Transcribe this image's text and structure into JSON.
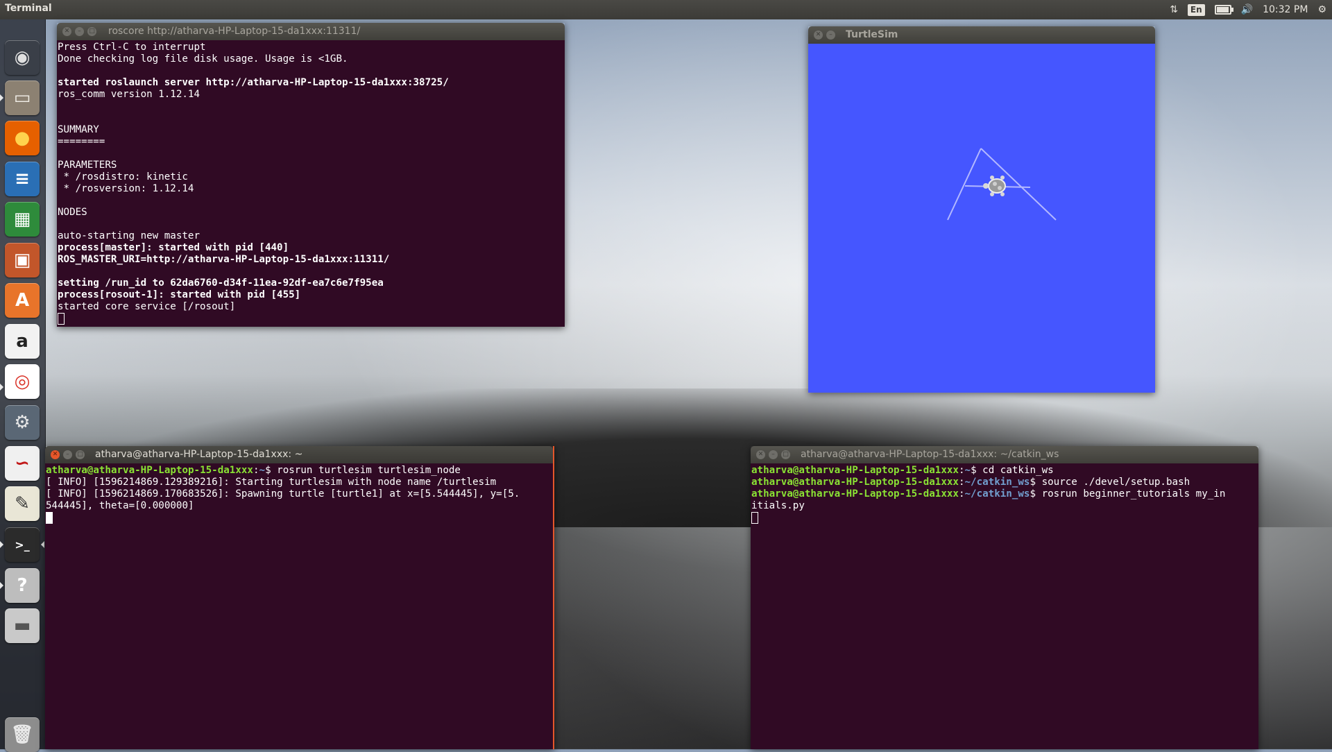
{
  "top_panel": {
    "app_name": "Terminal",
    "language": "En",
    "clock": "10:32 PM"
  },
  "launcher": {
    "items": [
      {
        "name": "dash-icon",
        "glyph": "◉"
      },
      {
        "name": "files-icon",
        "glyph": "▭"
      },
      {
        "name": "firefox-icon",
        "glyph": "●"
      },
      {
        "name": "writer-icon",
        "glyph": "≡"
      },
      {
        "name": "calc-icon",
        "glyph": "▦"
      },
      {
        "name": "impress-icon",
        "glyph": "▣"
      },
      {
        "name": "software-center-icon",
        "glyph": "A"
      },
      {
        "name": "amazon-icon",
        "glyph": "a"
      },
      {
        "name": "chrome-icon",
        "glyph": "◎"
      },
      {
        "name": "settings-icon",
        "glyph": "⚙"
      },
      {
        "name": "pdf-reader-icon",
        "glyph": "∽"
      },
      {
        "name": "text-editor-icon",
        "glyph": "✎"
      },
      {
        "name": "terminal-icon",
        "glyph": ">_"
      },
      {
        "name": "help-icon",
        "glyph": "?"
      },
      {
        "name": "drive-icon",
        "glyph": "▬"
      },
      {
        "name": "trash-icon",
        "glyph": "🗑"
      }
    ]
  },
  "roscore_window": {
    "title": "roscore http://atharva-HP-Laptop-15-da1xxx:11311/",
    "lines": [
      {
        "text": "Press Ctrl-C to interrupt",
        "bold": false
      },
      {
        "text": "Done checking log file disk usage. Usage is <1GB.",
        "bold": false
      },
      {
        "text": "",
        "bold": false
      },
      {
        "text": "started roslaunch server http://atharva-HP-Laptop-15-da1xxx:38725/",
        "bold": true
      },
      {
        "text": "ros_comm version 1.12.14",
        "bold": false
      },
      {
        "text": "",
        "bold": false
      },
      {
        "text": "",
        "bold": false
      },
      {
        "text": "SUMMARY",
        "bold": false
      },
      {
        "text": "========",
        "bold": false
      },
      {
        "text": "",
        "bold": false
      },
      {
        "text": "PARAMETERS",
        "bold": false
      },
      {
        "text": " * /rosdistro: kinetic",
        "bold": false
      },
      {
        "text": " * /rosversion: 1.12.14",
        "bold": false
      },
      {
        "text": "",
        "bold": false
      },
      {
        "text": "NODES",
        "bold": false
      },
      {
        "text": "",
        "bold": false
      },
      {
        "text": "auto-starting new master",
        "bold": false
      },
      {
        "text": "process[master]: started with pid [440]",
        "bold": true
      },
      {
        "text": "ROS_MASTER_URI=http://atharva-HP-Laptop-15-da1xxx:11311/",
        "bold": true
      },
      {
        "text": "",
        "bold": false
      },
      {
        "text": "setting /run_id to 62da6760-d34f-11ea-92df-ea7c6e7f95ea",
        "bold": true
      },
      {
        "text": "process[rosout-1]: started with pid [455]",
        "bold": true
      },
      {
        "text": "started core service [/rosout]",
        "bold": false
      }
    ]
  },
  "turtlesim_window": {
    "title": "TurtleSim",
    "background_color": "#4556ff",
    "pen_color": "#b3b8ff"
  },
  "turtlesim_node_window": {
    "title": "atharva@atharva-HP-Laptop-15-da1xxx: ~",
    "prompt_user": "atharva@atharva-HP-Laptop-15-da1xxx",
    "prompt_path": "~",
    "command": "rosrun turtlesim turtlesim_node",
    "output_lines": [
      "[ INFO] [1596214869.129389216]: Starting turtlesim with node name /turtlesim",
      "[ INFO] [1596214869.170683526]: Spawning turtle [turtle1] at x=[5.544445], y=[5.",
      "544445], theta=[0.000000]"
    ]
  },
  "catkin_window": {
    "title": "atharva@atharva-HP-Laptop-15-da1xxx: ~/catkin_ws",
    "prompt_user": "atharva@atharva-HP-Laptop-15-da1xxx",
    "commands": [
      {
        "path": "~",
        "cmd": "cd catkin_ws"
      },
      {
        "path": "~/catkin_ws",
        "cmd": "source ./devel/setup.bash"
      },
      {
        "path": "~/catkin_ws",
        "cmd": "rosrun beginner_tutorials my_in"
      }
    ],
    "wrapped_line": "itials.py"
  },
  "colors": {
    "terminal_bg": "#300a24",
    "prompt_green": "#8ae234",
    "path_blue": "#729fcf",
    "close_orange": "#e5562a"
  }
}
